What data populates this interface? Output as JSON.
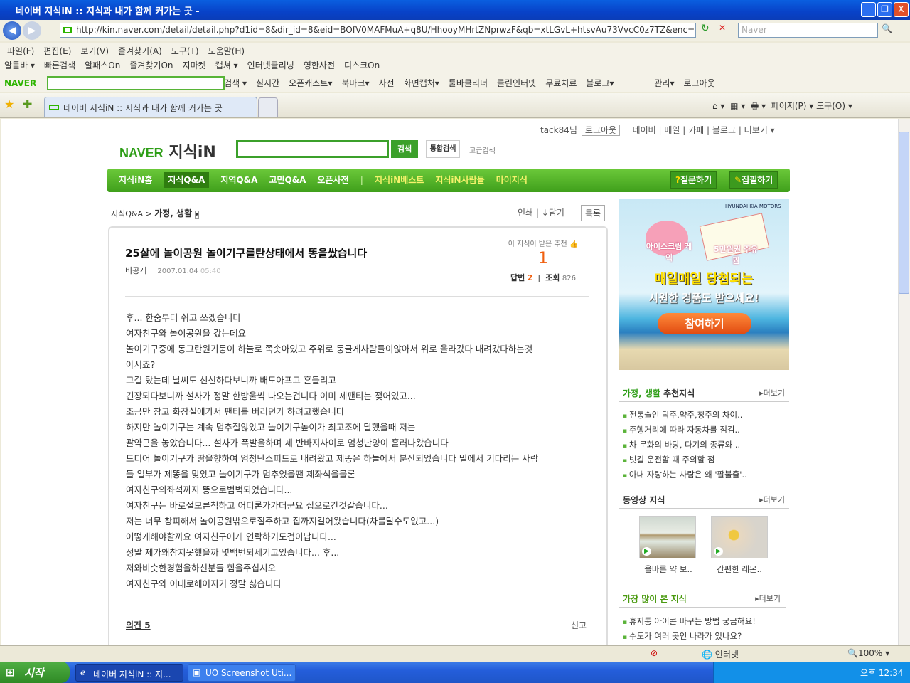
{
  "window": {
    "title": "네이버 지식iN :: 지식과 내가 함께 커가는 곳 -",
    "min": "_",
    "max": "❐",
    "close": "X"
  },
  "address": {
    "url": "http://kin.naver.com/detail/detail.php?d1id=8&dir_id=8&eid=BOfV0MAFMuA+q8U/HhooyMHrtZNprwzF&qb=xtLGvL+htsvAu73VvcC0z7TZ&enc=euc-kr&sec",
    "search_placeholder": "Naver"
  },
  "menu": [
    "파일(F)",
    "편집(E)",
    "보기(V)",
    "즐겨찾기(A)",
    "도구(T)",
    "도움말(H)"
  ],
  "links_toolbar": [
    "알툴바 ▾",
    "빠른검색",
    "알패스On",
    "즐겨찾기On",
    "지마켓",
    "캡쳐 ▾",
    "인터넷클리닝",
    "영한사전",
    "디스크On"
  ],
  "naver_toolbar": {
    "logo": "NAVER",
    "items": [
      "검색 ▾",
      "실시간",
      "오픈캐스트▾",
      "북마크▾",
      "사전",
      "화면캡처▾",
      "툴바클리너",
      "클린인터넷",
      "무료치료",
      "블로그▾"
    ],
    "right": [
      "관리▾",
      "로그아웃"
    ]
  },
  "tab": {
    "label": "네이버 지식iN :: 지식과 내가 함께 커가는 곳"
  },
  "ie_commands": [
    "페이지(P) ▾",
    "도구(O) ▾"
  ],
  "page": {
    "user": "tack84님",
    "logout": "로그아웃",
    "top_links": [
      "네이버",
      "메일",
      "카페",
      "블로그",
      "더보기"
    ],
    "logo_naver": "NAVER",
    "logo_kin": "지식iN",
    "search_btn": "검색",
    "total_search": "통합검색",
    "adv_search": "고급검색",
    "nav": [
      "지식iN홈",
      "지식Q&A",
      "지역Q&A",
      "고민Q&A",
      "오픈사전"
    ],
    "nav2": [
      "지식iN베스트",
      "지식iN사람들",
      "마이지식"
    ],
    "ask": "질문하기",
    "write": "집필하기",
    "breadcrumb": {
      "parent": "지식Q&A >",
      "current": "가정, 생활"
    },
    "tools": {
      "print": "인쇄",
      "save": "담기",
      "list": "목록"
    },
    "article": {
      "title": "25살에 놀이공원 놀이기구를탄상태에서 똥을쌌습니다",
      "author": "비공개",
      "date": "2007.01.04",
      "time": "05:40",
      "rec_label": "이 지식이 받은 추천",
      "rec_count": "1",
      "answers_label": "답변",
      "answers": "2",
      "views_label": "조회",
      "views": "826",
      "body": [
        "후... 한숨부터 쉬고 쓰겠습니다",
        "여자친구와 놀이공원을 갔는데요",
        "놀이기구중에 동그란원기둥이 하늘로 쭉솟아있고 주위로 둥글게사람들이앉아서 위로 올라갔다 내려갔다하는것",
        "아시죠?",
        "그걸 탔는데 날씨도 선선하다보니까 배도아프고 흔들리고",
        "긴장되다보니까 설사가 정말 한방울씩 나오는겁니다 이미 제팬티는 젖어있고...",
        "조금만 참고 화장실에가서 팬티를 버리던가 하려고했습니다",
        "하지만 놀이기구는 계속 멈추질않았고 놀이기구높이가 최고조에 달했을때 저는",
        "괄약근을 놓았습니다... 설사가 폭발을하며 제 반바지사이로 엄청난양이 흘러나왔습니다",
        "드디어 놀이기구가 땅을향하여 엄청난스피드로 내려왔고 제똥은 하늘에서 분산되었습니다 밑에서 기다리는 사람",
        "들 일부가 제똥을 맞았고 놀이기구가 멈추었을땐 제좌석을물론",
        "여자친구의좌석까지 똥으로범벅되었습니다...",
        "여자친구는 바로절모른척하고 어디론가가더군요 집으로간것같습니다...",
        "저는 너무 창피해서 놀이공원밖으로질주하고 집까지걸어왔습니다(차를탈수도없고...)",
        "어떻게해야할까요 여자친구에게 연락하기도겁이납니다...",
        "정말 제가왜참지못했을까 몇백번되세기고있습니다... 후...",
        "저와비슷한경험을하신분들 힘을주십시오",
        "여자친구와 이대로헤어지기 정말 싫습니다"
      ],
      "comments": "의견 5",
      "report": "신고"
    },
    "ad": {
      "item1": "아이스크림 케익",
      "item2": "5만원권 주유권",
      "headline1": "매일매일 당첨되는",
      "headline2": "시원한 경품도 받으세요!",
      "cta": "참여하기",
      "brands": "HYUNDAI KIA MOTORS"
    },
    "sidebar": {
      "rec": {
        "title_green": "가정, 생활",
        "title": "추천지식",
        "more": "더보기",
        "items": [
          "전통술인 탁주,약주,청주의 차이..",
          "주행거리에 따라 자동차를 점검..",
          "차 문화의 바탕, 다기의 종류와 ..",
          "빗길 운전할 때 주의할 점",
          "아내 자랑하는 사람은 왜 '팔불출'.."
        ]
      },
      "video": {
        "title": "동영상 지식",
        "more": "더보기",
        "items": [
          "올바른 약 보..",
          "간편한 레몬.."
        ]
      },
      "top": {
        "title": "가장 많이 본 지식",
        "more": "더보기",
        "items": [
          "휴지통 아이콘 바꾸는 방법 궁금해요!",
          "수도가 여러 곳인 나라가 있나요?"
        ]
      }
    }
  },
  "status": {
    "zone": "인터넷",
    "zoom": "100%"
  },
  "taskbar": {
    "start": "시작",
    "tasks": [
      "네이버 지식iN :: 지...",
      "UO Screenshot Uti..."
    ],
    "clock": "오후 12:34"
  }
}
